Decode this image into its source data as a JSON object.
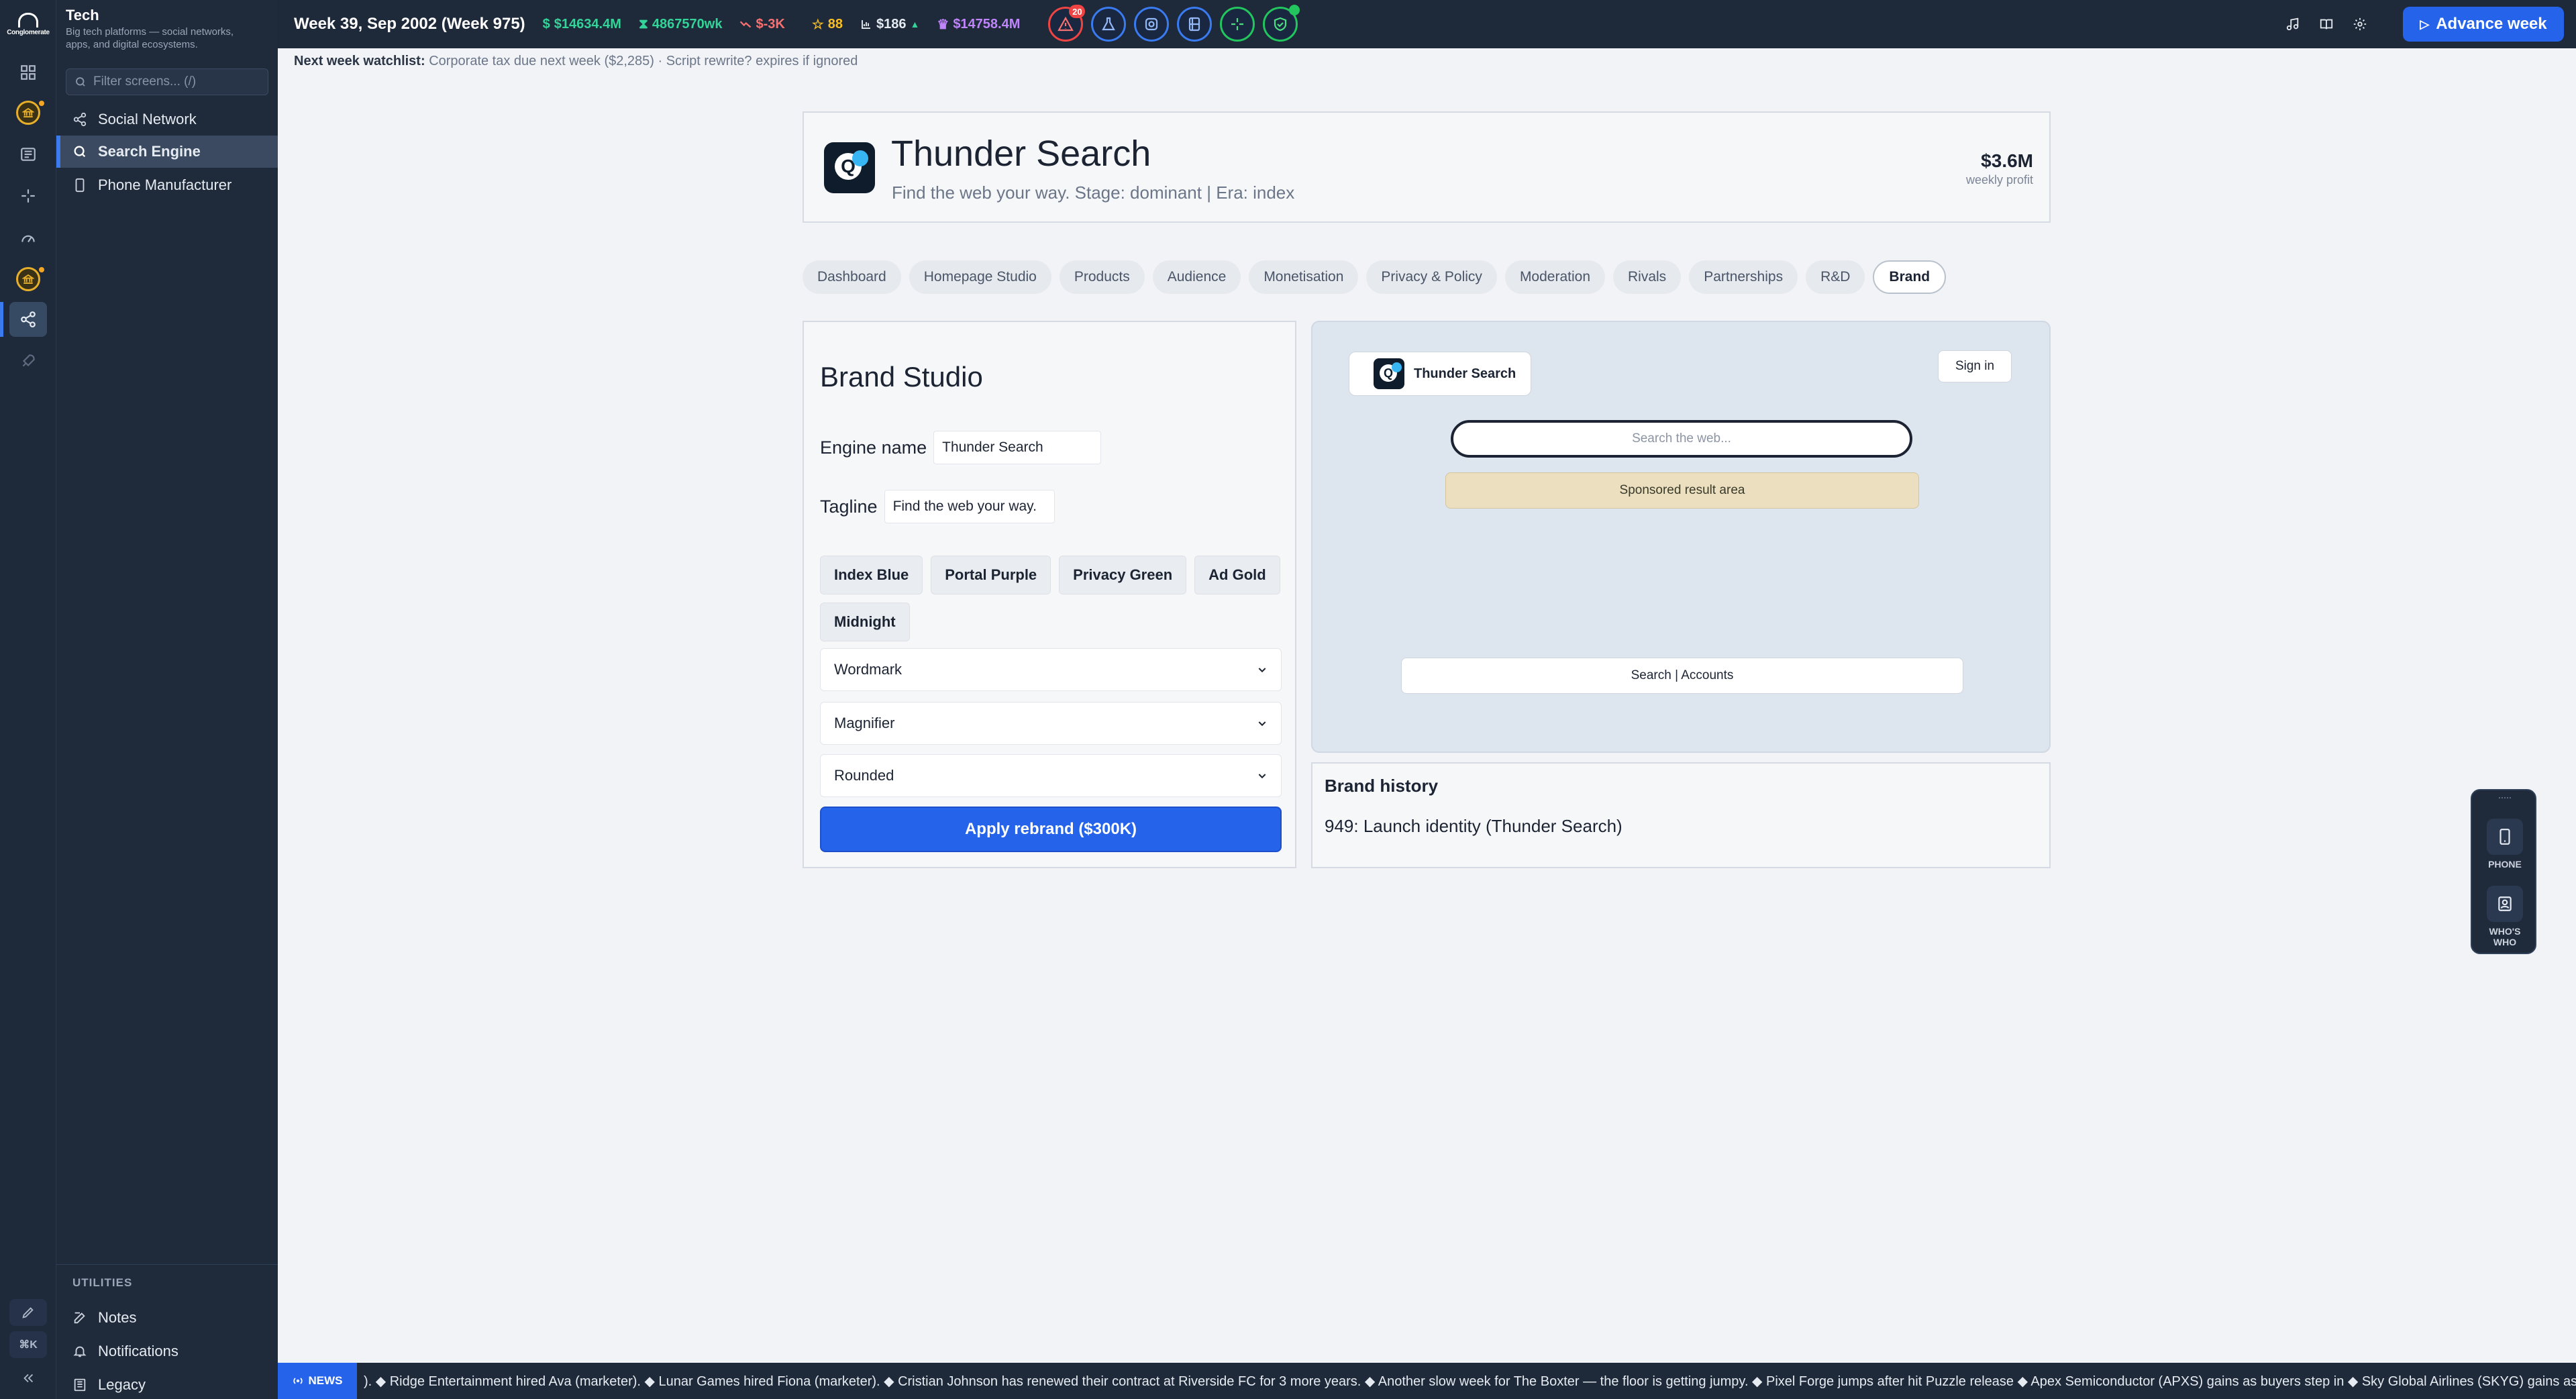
{
  "app": {
    "logo_word": "Conglomerate",
    "section_title": "Tech",
    "section_description": "Big tech platforms — social networks, apps, and digital ecosystems."
  },
  "sidebar": {
    "filter_placeholder": "Filter screens... (/)",
    "items": [
      {
        "label": "Social Network",
        "icon": "share-icon"
      },
      {
        "label": "Search Engine",
        "icon": "search-icon",
        "active": true
      },
      {
        "label": "Phone Manufacturer",
        "icon": "phone-icon"
      }
    ],
    "utilities_title": "UTILITIES",
    "utilities": [
      {
        "label": "Notes",
        "icon": "notes-icon"
      },
      {
        "label": "Notifications",
        "icon": "bell-icon"
      },
      {
        "label": "Legacy",
        "icon": "legacy-icon"
      }
    ],
    "shortcut_label": "⌘K"
  },
  "topbar": {
    "week": "Week 39, Sep 2002 (Week 975)",
    "cash": "$14634.4M",
    "income": "4867570wk",
    "delta": "$-3K",
    "rating": "88",
    "stock": "$186",
    "net_worth": "$14758.4M",
    "alerts_badge": "20",
    "advance_label": "Advance week"
  },
  "watchlist": {
    "label": "Next week watchlist:",
    "text": "Corporate tax due next week ($2,285) · Script rewrite? expires if ignored"
  },
  "company": {
    "name": "Thunder Search",
    "subtitle": "Find the web your way. Stage: dominant | Era: index",
    "profit": "$3.6M",
    "profit_label": "weekly profit",
    "logo_letter": "Q"
  },
  "tabs": [
    "Dashboard",
    "Homepage Studio",
    "Products",
    "Audience",
    "Monetisation",
    "Privacy & Policy",
    "Moderation",
    "Rivals",
    "Partnerships",
    "R&D",
    "Brand"
  ],
  "active_tab": "Brand",
  "studio": {
    "title": "Brand Studio",
    "engine_name_label": "Engine name",
    "engine_name_value": "Thunder Search",
    "tagline_label": "Tagline",
    "tagline_value": "Find the web your way.",
    "palettes": [
      "Index Blue",
      "Portal Purple",
      "Privacy Green",
      "Ad Gold",
      "Midnight"
    ],
    "logo_style": "Wordmark",
    "icon_style": "Magnifier",
    "shape_style": "Rounded",
    "apply_label": "Apply rebrand ($300K)"
  },
  "preview": {
    "brand_name": "Thunder Search",
    "signin_label": "Sign in",
    "search_placeholder": "Search the web...",
    "sponsored_label": "Sponsored result area",
    "footer_links": "Search | Accounts"
  },
  "history": {
    "title": "Brand history",
    "entries": [
      "949: Launch identity (Thunder Search)"
    ]
  },
  "floater": {
    "phone_label": "PHONE",
    "whos_who_label": "WHO'S WHO"
  },
  "ticker": {
    "tag": "NEWS",
    "text": "). ◆ Ridge Entertainment hired Ava (marketer). ◆ Lunar Games hired Fiona (marketer). ◆ Cristian Johnson has renewed their contract at Riverside FC for 3 more years. ◆ Another slow week for The Boxter — the floor is getting jumpy. ◆ Pixel Forge jumps after hit Puzzle release ◆ Apex Semiconductor (APXS) gains as buyers step in ◆ Sky Global Airlines (SKYG) gains as buyers step in ◆"
  },
  "colors": {
    "accent": "#2563eb",
    "sidebar_bg": "#1f2a3a",
    "topbar_bg": "#1e2939",
    "positive": "#34d399",
    "negative": "#f87171",
    "sponsored_bg": "#ebdfc0"
  }
}
